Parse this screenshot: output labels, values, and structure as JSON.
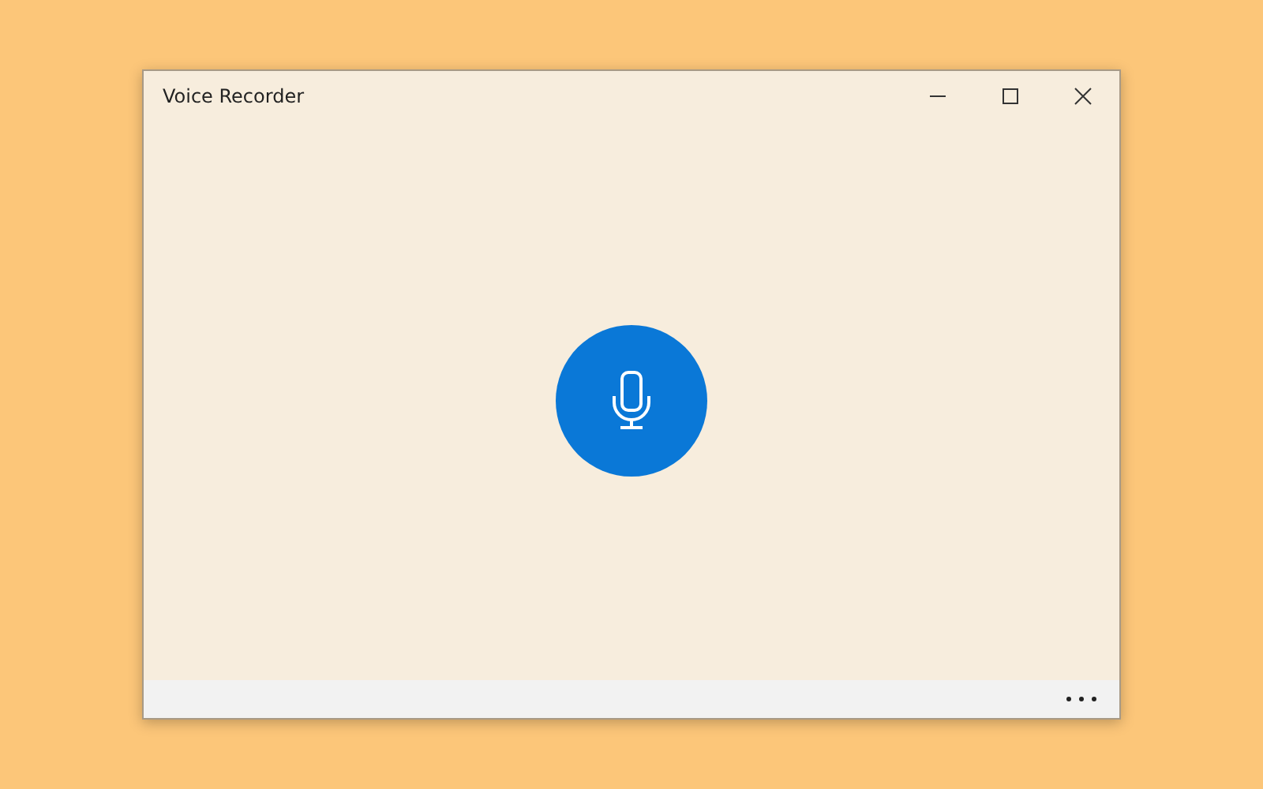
{
  "window": {
    "title": "Voice Recorder"
  }
}
